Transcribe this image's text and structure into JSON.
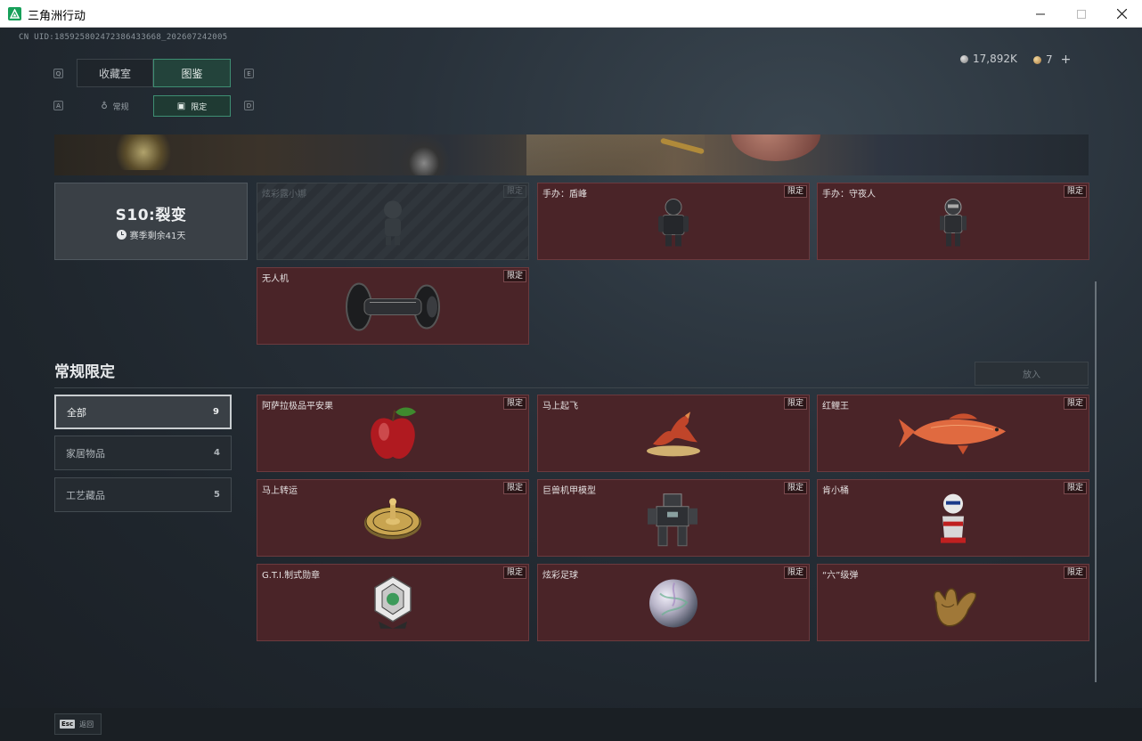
{
  "window": {
    "title": "三角洲行动"
  },
  "uid": "CN UID:1859258024723864336​68_202607242005",
  "currency": {
    "silver": "17,892K",
    "gold": "7",
    "plus": "+"
  },
  "tabs": {
    "left_key": "Q",
    "right_key": "E",
    "collection": "收藏室",
    "atlas": "图鉴"
  },
  "subtabs": {
    "left_key": "A",
    "right_key": "D",
    "normal": "常规",
    "limited": "限定"
  },
  "season": {
    "title": "S10:裂变",
    "remaining": "赛季剩余41天"
  },
  "season_items": [
    {
      "name": "炫彩露小娜",
      "tag": "限定",
      "locked": true,
      "icon": "figure-icon"
    },
    {
      "name": "手办：盾峰",
      "tag": "限定",
      "locked": false,
      "icon": "armored-figure-icon"
    },
    {
      "name": "手办：守夜人",
      "tag": "限定",
      "locked": false,
      "icon": "night-watch-figure-icon"
    },
    {
      "name": "无人机",
      "tag": "限定",
      "locked": false,
      "icon": "drone-icon"
    }
  ],
  "section": {
    "title": "常规限定",
    "place_button": "放入"
  },
  "filters": [
    {
      "label": "全部",
      "count": "9",
      "active": true
    },
    {
      "label": "家居物品",
      "count": "4",
      "active": false
    },
    {
      "label": "工艺藏品",
      "count": "5",
      "active": false
    }
  ],
  "items": [
    {
      "name": "阿萨拉极品平安果",
      "tag": "限定",
      "icon": "apple-icon"
    },
    {
      "name": "马上起飞",
      "tag": "限定",
      "icon": "horse-statue-icon"
    },
    {
      "name": "红鲤王",
      "tag": "限定",
      "icon": "carp-icon"
    },
    {
      "name": "马上转运",
      "tag": "限定",
      "icon": "golden-disc-icon"
    },
    {
      "name": "巨兽机甲模型",
      "tag": "限定",
      "icon": "mech-model-icon"
    },
    {
      "name": "肯小桶",
      "tag": "限定",
      "icon": "bucket-figure-icon"
    },
    {
      "name": "G.T.I.制式勋章",
      "tag": "限定",
      "icon": "medal-icon"
    },
    {
      "name": "炫彩足球",
      "tag": "限定",
      "icon": "football-icon"
    },
    {
      "name": "“六”级弹",
      "tag": "限定",
      "icon": "hand-sign-icon"
    }
  ],
  "bottom": {
    "esc_key": "Esc",
    "esc_label": "返回"
  }
}
